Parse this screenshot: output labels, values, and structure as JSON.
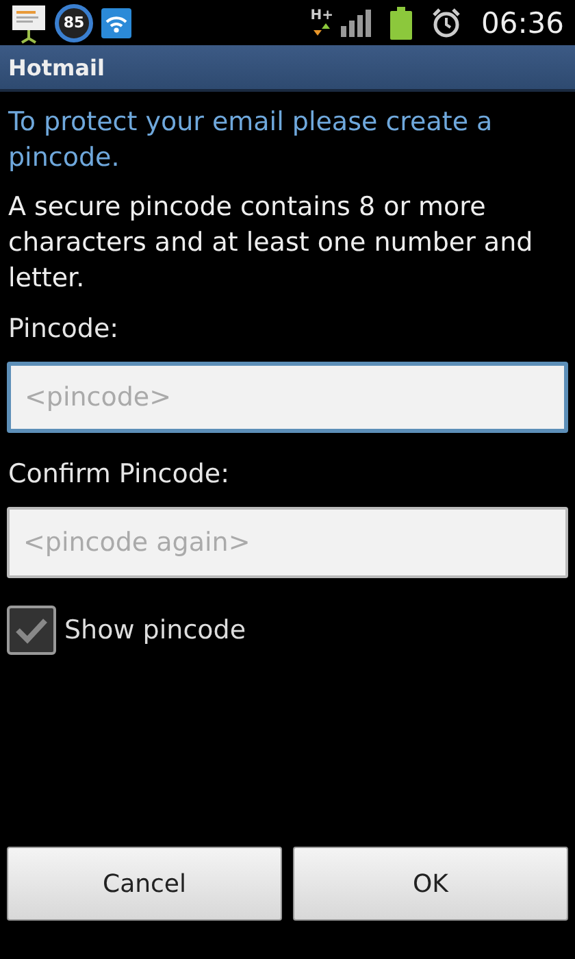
{
  "status_bar": {
    "battery_percent": "85",
    "network_type": "H+",
    "time": "06:36"
  },
  "window": {
    "title": "Hotmail"
  },
  "intro": "To protect your email please create a pincode.",
  "description": "A secure pincode contains 8 or more characters and at least one number and letter.",
  "fields": [
    {
      "label": "Pincode:",
      "placeholder": "<pincode>",
      "focused": true
    },
    {
      "label": "Confirm Pincode:",
      "placeholder": "<pincode again>",
      "focused": false
    }
  ],
  "show_pincode": {
    "label": "Show pincode",
    "checked": true
  },
  "buttons": [
    "Cancel",
    "OK"
  ]
}
